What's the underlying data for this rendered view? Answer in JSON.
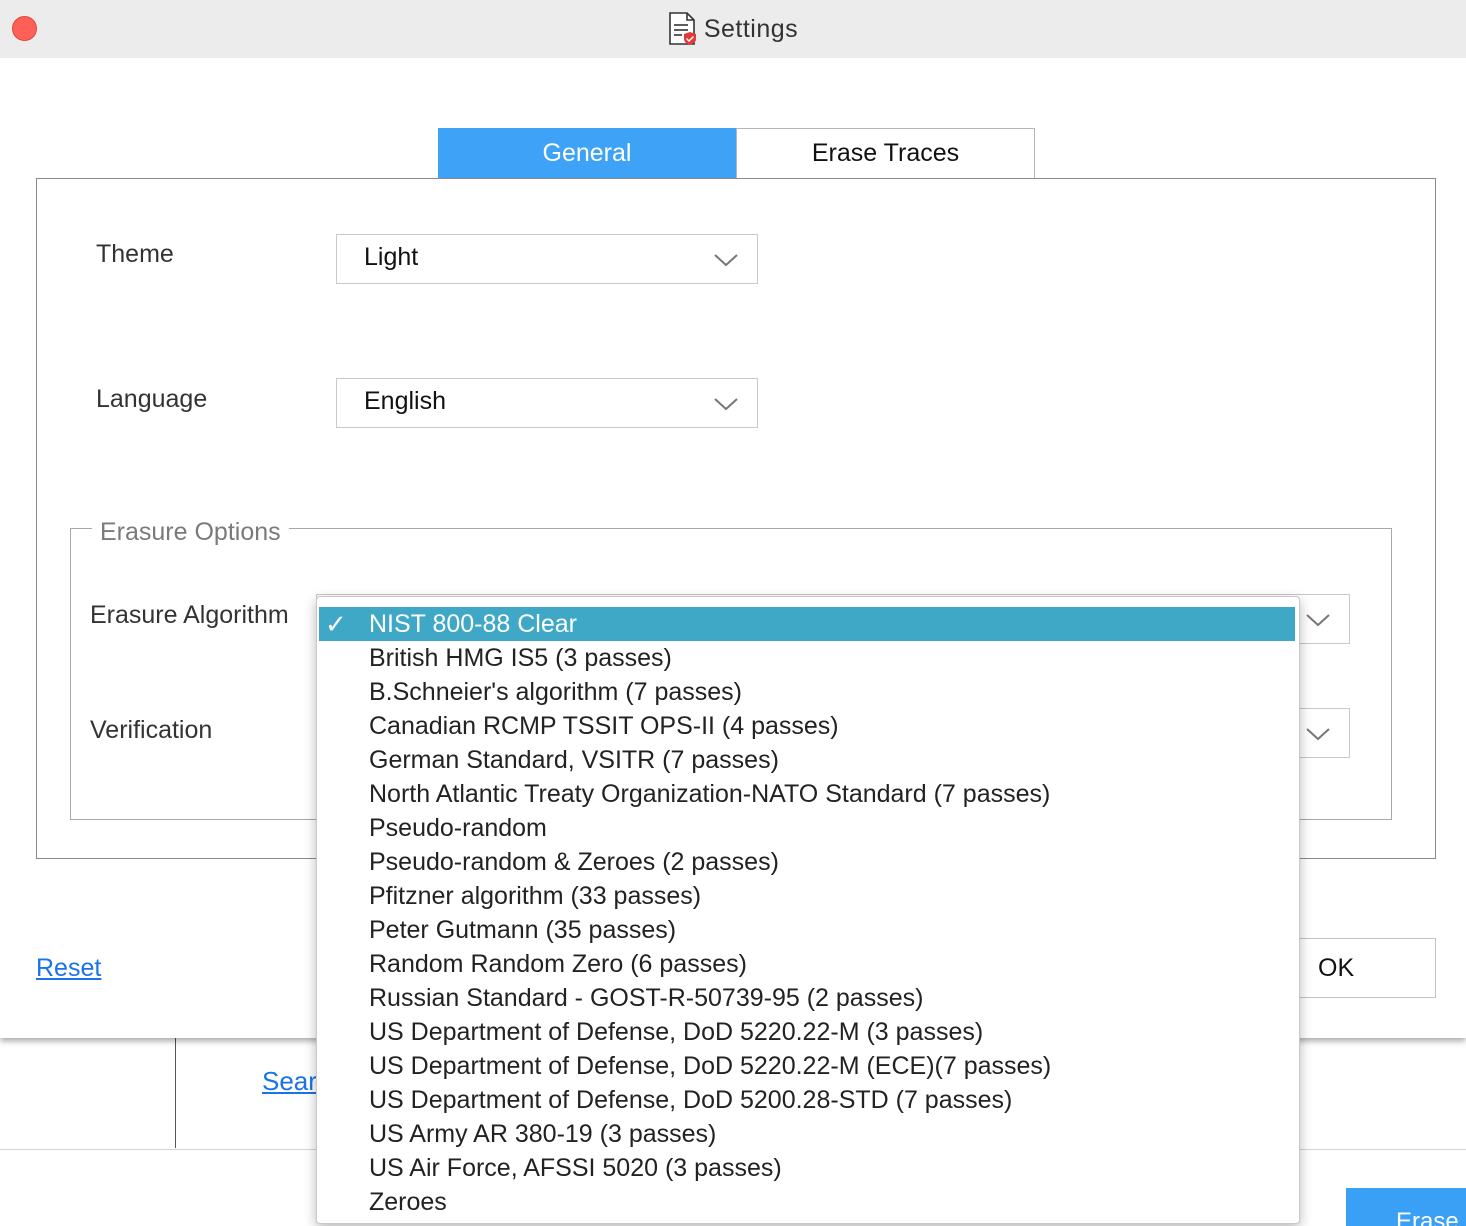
{
  "window": {
    "title": "Settings",
    "close_color": "#fe5f57"
  },
  "tabs": [
    {
      "label": "General",
      "active": true
    },
    {
      "label": "Erase Traces",
      "active": false
    }
  ],
  "general": {
    "theme": {
      "label": "Theme",
      "value": "Light"
    },
    "language": {
      "label": "Language",
      "value": "English"
    }
  },
  "erasure_options": {
    "title": "Erasure Options",
    "algorithm": {
      "label": "Erasure Algorithm",
      "value": "NIST 800-88 Clear"
    },
    "verification": {
      "label": "Verification"
    }
  },
  "dropdown": {
    "items": [
      "NIST 800-88 Clear",
      "British HMG IS5 (3 passes)",
      "B.Schneier's algorithm (7 passes)",
      "Canadian RCMP TSSIT OPS-II (4 passes)",
      "German Standard, VSITR (7 passes)",
      "North Atlantic Treaty Organization-NATO Standard (7 passes)",
      "Pseudo-random",
      "Pseudo-random & Zeroes (2 passes)",
      "Pfitzner algorithm (33 passes)",
      "Peter Gutmann (35 passes)",
      "Random Random Zero (6 passes)",
      "Russian Standard - GOST-R-50739-95 (2 passes)",
      "US Department of Defense, DoD 5220.22-M (3 passes)",
      "US Department of Defense, DoD 5220.22-M (ECE)(7 passes)",
      "US Department of Defense, DoD 5200.28-STD (7 passes)",
      "US Army AR 380-19 (3 passes)",
      "US Air Force, AFSSI 5020 (3 passes)",
      "Zeroes"
    ],
    "selected_index": 0,
    "check_glyph": "✓",
    "highlight_color": "#3fa8c7"
  },
  "footer": {
    "reset_label": "Reset",
    "ok_label": "OK"
  },
  "background_window": {
    "search_label": "Sear",
    "erase_label": "Erase"
  },
  "colors": {
    "accent": "#3ea3f7",
    "link": "#1a73e8"
  }
}
